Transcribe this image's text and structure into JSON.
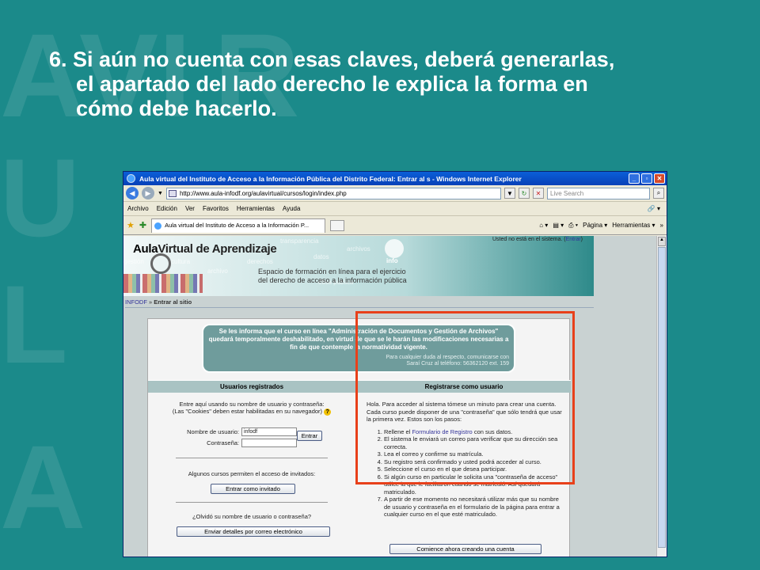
{
  "background_letters": [
    "A",
    "V",
    "I",
    "R",
    "U",
    "L",
    "A"
  ],
  "slide": {
    "title_line1": "6. Si aún no cuenta con esas claves, deberá generarlas,",
    "title_line2": "el apartado del lado derecho le explica la forma en",
    "title_line3": "cómo debe hacerlo."
  },
  "window": {
    "title": "Aula virtual del Instituto de Acceso a la Información Pública del Distrito Federal: Entrar al s - Windows Internet Explorer",
    "url": "http://www.aula-infodf.org/aulavirtual/cursos/login/index.php",
    "search_placeholder": "Live Search",
    "menu": [
      "Archivo",
      "Edición",
      "Ver",
      "Favoritos",
      "Herramientas",
      "Ayuda"
    ],
    "tab_label": "Aula virtual del Instituto de Acceso a la Información P...",
    "page_tool": "Página",
    "tools_tool": "Herramientas"
  },
  "site": {
    "logo_a": "Aula",
    "logo_b": "Virtual de Aprendizaje",
    "ghost_words": [
      "transparencia",
      "archivos",
      "cultura",
      "derechos",
      "datos",
      "gestión",
      "ética pública",
      "archivo"
    ],
    "tagline1": "Espacio de formación en línea para el ejercicio",
    "tagline2": "del derecho de acceso a la información pública",
    "info_logo": "info",
    "user_status": "Usted no está en el sistema. (",
    "user_link": "Entrar",
    "user_close": ")",
    "crumb_home": "INFODF",
    "crumb_sep": " » ",
    "crumb_current": "Entrar al sitio"
  },
  "notice": {
    "line1": "Se les informa que el curso en línea ",
    "course": "\"Administración de Documentos y Gestión de Archivos\"",
    "line2": " quedará temporalmente deshabilitado, en virtud de que se le harán las modificaciones necesarias a fin de que contemple la normatividad vigente.",
    "contact1": "Para cualquier duda al respecto, comunicarse con",
    "contact2": "Saraí Cruz al teléfono: 56362120 ext. 159"
  },
  "login": {
    "header": "Usuarios registrados",
    "intro1": "Entre aquí usando su nombre de usuario y contraseña:",
    "intro2": "(Las \"Cookies\" deben estar habilitadas en su navegador)",
    "help_icon": "?",
    "user_label": "Nombre de usuario:",
    "user_value": "infodf",
    "pass_label": "Contraseña:",
    "pass_value": "",
    "submit": "Entrar",
    "guest_text": "Algunos cursos permiten el acceso de invitados:",
    "guest_button": "Entrar como invitado",
    "forgot_text": "¿Olvidó su nombre de usuario o contraseña?",
    "forgot_button": "Enviar detalles por correo electrónico"
  },
  "signup": {
    "header": "Registrarse como usuario",
    "intro": "Hola. Para acceder al sistema tómese un minuto para crear una cuenta. Cada curso puede disponer de una \"contraseña\" que sólo tendrá que usar la primera vez. Estos son los pasos:",
    "step1_a": "Rellene el ",
    "step1_link": "Formulario de Registro",
    "step1_b": " con sus datos.",
    "steps": [
      "El sistema le enviará un correo para verificar que su dirección sea correcta.",
      "Lea el correo y confirme su matrícula.",
      "Su registro será confirmado y usted podrá acceder al curso.",
      "Seleccione el curso en el que desea participar.",
      "Si algún curso en particular le solicita una \"contraseña de acceso\" utilice la que le facilitaron cuando se matriculó. Así quedará matriculado.",
      "A partir de ese momento no necesitará utilizar más que su nombre de usuario y contraseña en el formulario de la página para entrar a cualquier curso en el que esté matriculado."
    ],
    "button": "Comience ahora creando una cuenta"
  },
  "colors": {
    "slide_bg": "#1b8a8a",
    "highlight": "#e8401a",
    "link": "#333399"
  }
}
